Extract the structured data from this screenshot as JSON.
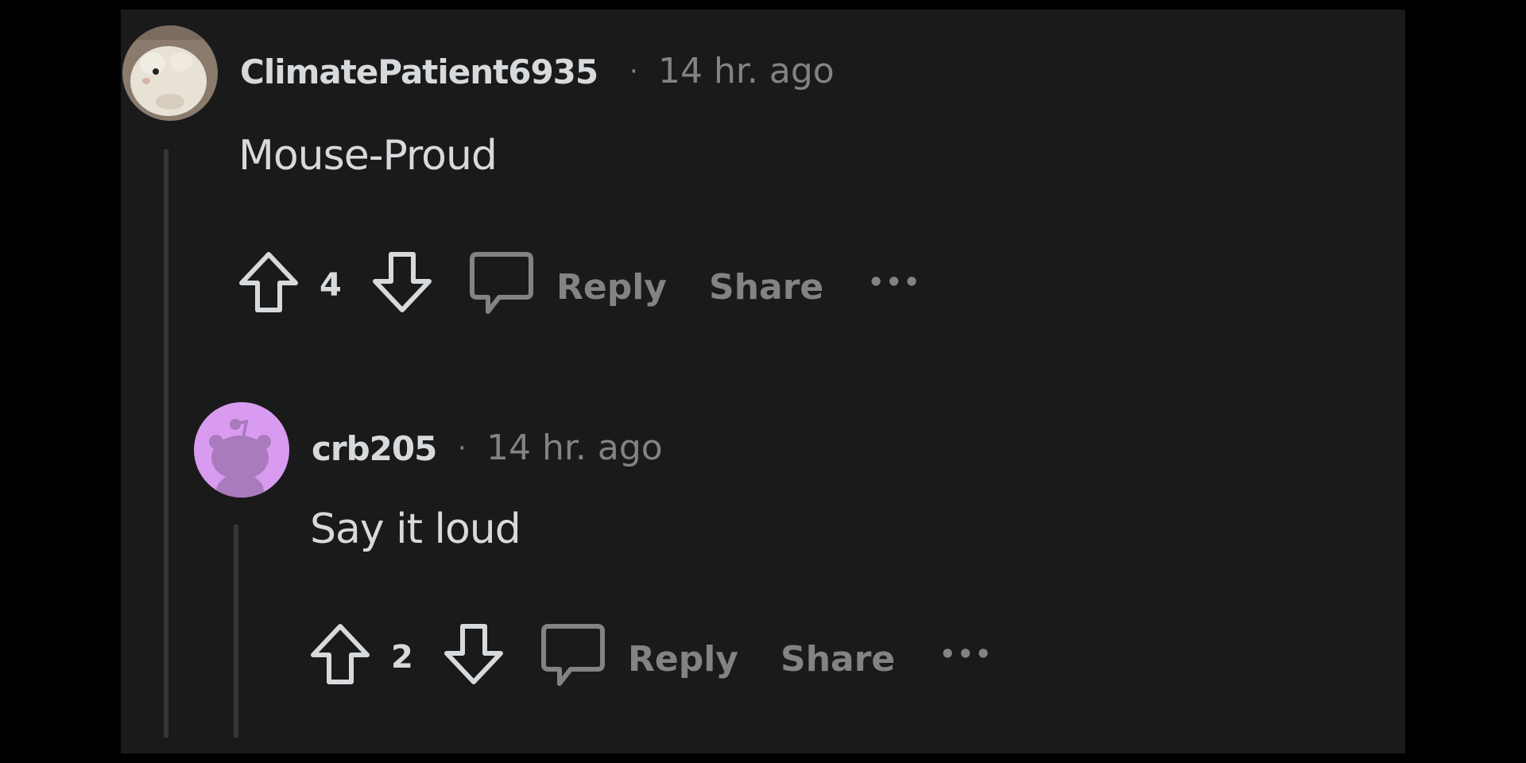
{
  "comments": [
    {
      "username": "ClimatePatient6935",
      "separator": "·",
      "timestamp": "14 hr. ago",
      "body": "Mouse-Proud",
      "votes": "4",
      "reply_label": "Reply",
      "share_label": "Share",
      "more_label": "•••",
      "avatar_icon": "hamster-photo-avatar"
    },
    {
      "username": "crb205",
      "separator": "·",
      "timestamp": "14 hr. ago",
      "body": "Say it loud",
      "votes": "2",
      "reply_label": "Reply",
      "share_label": "Share",
      "more_label": "•••",
      "avatar_icon": "snoo-avatar",
      "avatar_color": "#d89bf0"
    }
  ],
  "colors": {
    "background": "#1a1a1b",
    "outer_background": "#000000",
    "text_primary": "#d7dadc",
    "text_secondary": "#818384",
    "thread_line": "#343536"
  }
}
